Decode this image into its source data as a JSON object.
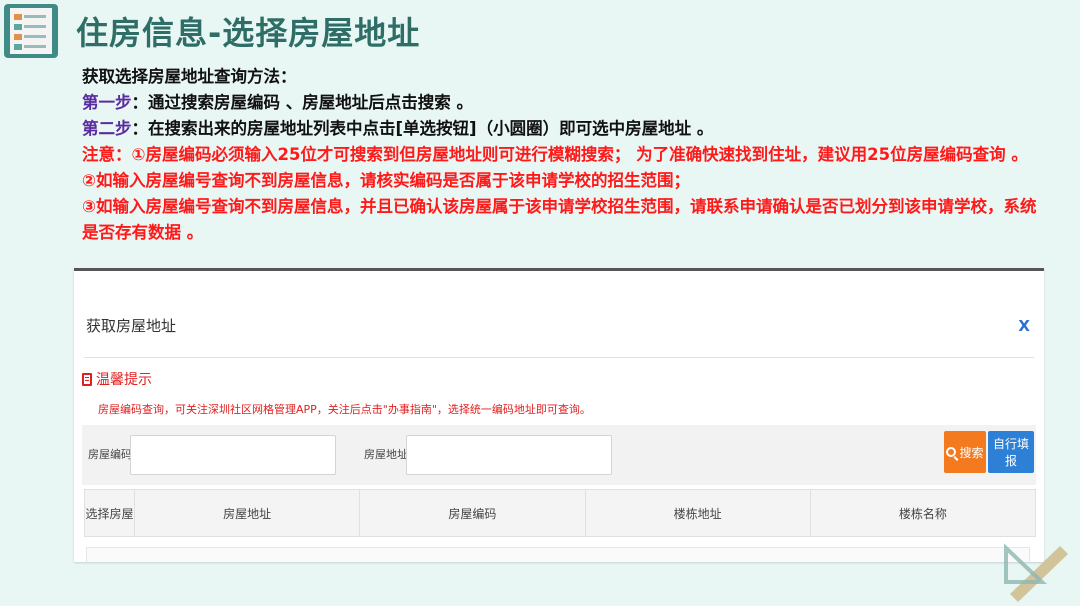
{
  "slide": {
    "title": "住房信息-选择房屋地址",
    "line1": "获取选择房屋地址查询方法：",
    "step1_label": "第一步",
    "step1_text": "：通过搜索房屋编码 、房屋地址后点击搜索 。",
    "step2_label": "第二步",
    "step2_text": "：在搜索出来的房屋地址列表中点击[单选按钮]（小圆圈）即可选中房屋地址 。",
    "note1": "注意：①房屋编码必须输入25位才可搜索到但房屋地址则可进行模糊搜索； 为了准确快速找到住址，建议用25位房屋编码查询 。",
    "note2": "②如输入房屋编号查询不到房屋信息，请核实编码是否属于该申请学校的招生范围；",
    "note3": "③如输入房屋编号查询不到房屋信息，并且已确认该房屋属于该申请学校招生范围，请联系申请确认是否已划分到该申请学校，系统是否存有数据 。"
  },
  "dialog": {
    "title": "获取房屋地址",
    "close": "X",
    "tip_title": "温馨提示",
    "tip_text": "房屋编码查询，可关注深圳社区网格管理APP，关注后点击\"办事指南\"，选择统一编码地址即可查询。",
    "house_code_label": "房屋编码",
    "house_code_value": "",
    "house_addr_label": "房屋地址",
    "house_addr_value": "",
    "search_button": "搜索",
    "self_fill_button": "自行填报",
    "columns": [
      "选择房屋",
      "房屋地址",
      "房屋编码",
      "楼栋地址",
      "楼栋名称"
    ]
  },
  "colors": {
    "title": "#2e6e67",
    "step_label": "#5b2c9e",
    "note": "#ff1a1a",
    "search_btn": "#f47a20",
    "self_fill_btn": "#2e7fd6"
  }
}
